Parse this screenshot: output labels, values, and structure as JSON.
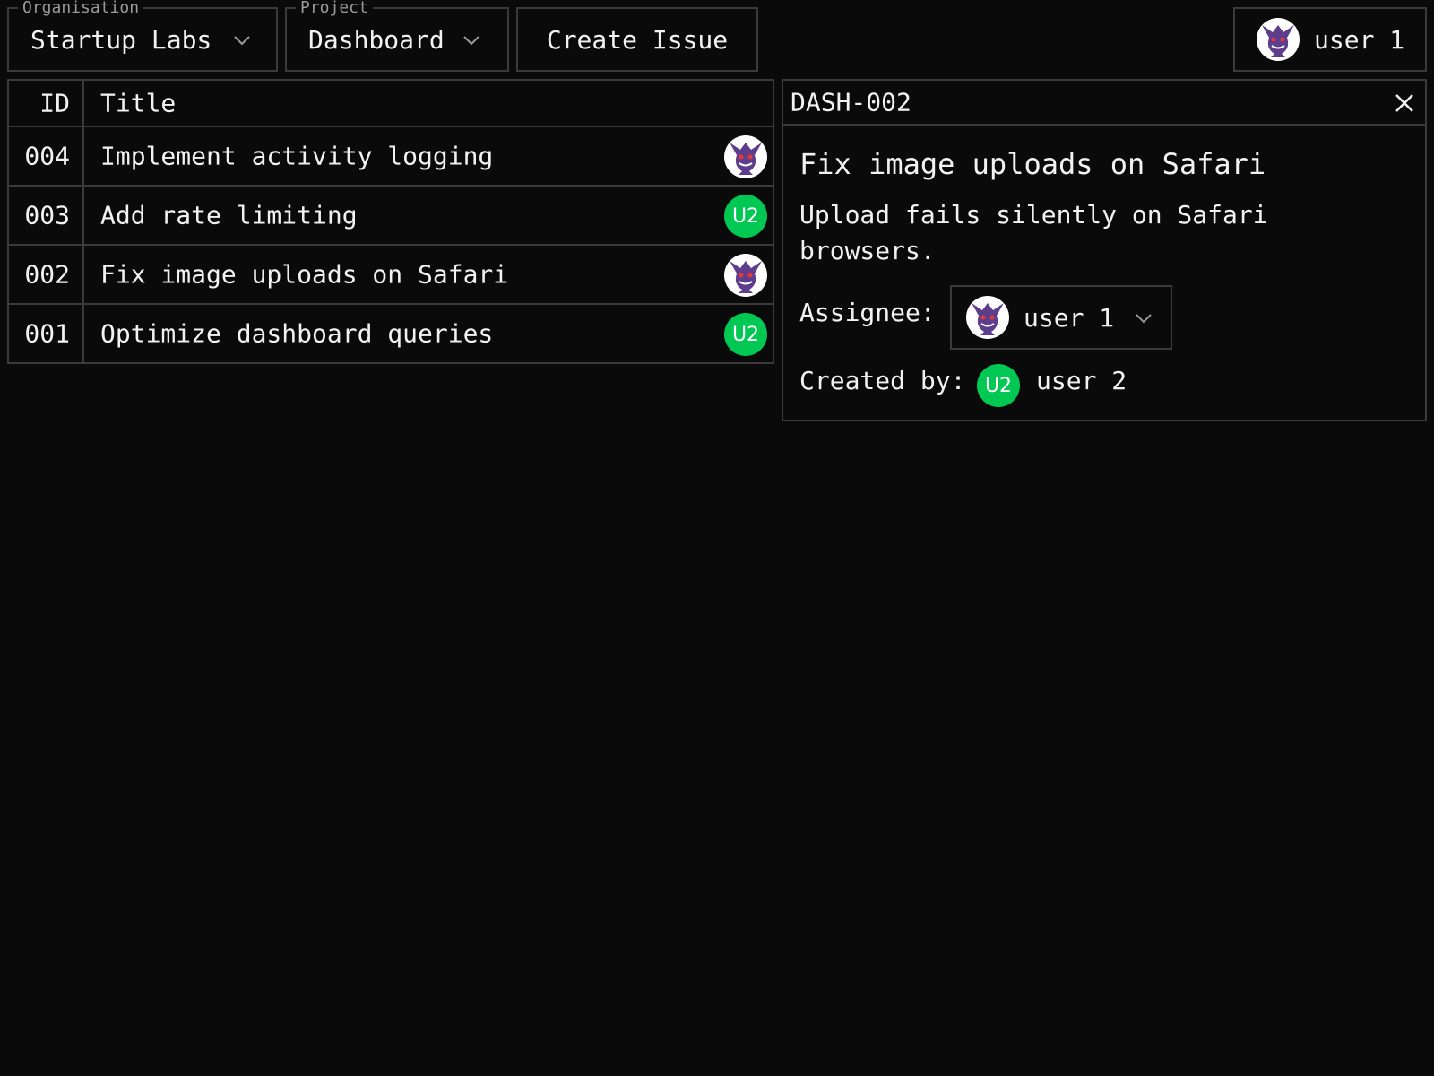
{
  "toolbar": {
    "organisation": {
      "label": "Organisation",
      "value": "Startup Labs"
    },
    "project": {
      "label": "Project",
      "value": "Dashboard"
    },
    "create_issue_label": "Create Issue",
    "current_user": {
      "name": "user 1",
      "avatar": "ghost-avatar"
    }
  },
  "table": {
    "headers": {
      "id": "ID",
      "title": "Title"
    },
    "rows": [
      {
        "id": "004",
        "title": "Implement activity logging",
        "assignee": "ghost-avatar"
      },
      {
        "id": "003",
        "title": "Add rate limiting",
        "assignee": "U2"
      },
      {
        "id": "002",
        "title": "Fix image uploads on Safari",
        "assignee": "ghost-avatar"
      },
      {
        "id": "001",
        "title": "Optimize dashboard queries",
        "assignee": "U2"
      }
    ]
  },
  "detail": {
    "key": "DASH-002",
    "title": "Fix image uploads on Safari",
    "description": "Upload fails silently on Safari browsers.",
    "assignee_label": "Assignee:",
    "assignee_name": "user 1",
    "created_by_label": "Created by:",
    "created_by_initials": "U2",
    "created_by_name": "user 2"
  },
  "colors": {
    "background": "#0a0a0a",
    "border": "#3a3a3a",
    "u2_avatar": "#00c853",
    "ghost_purple": "#5e3e8c"
  }
}
